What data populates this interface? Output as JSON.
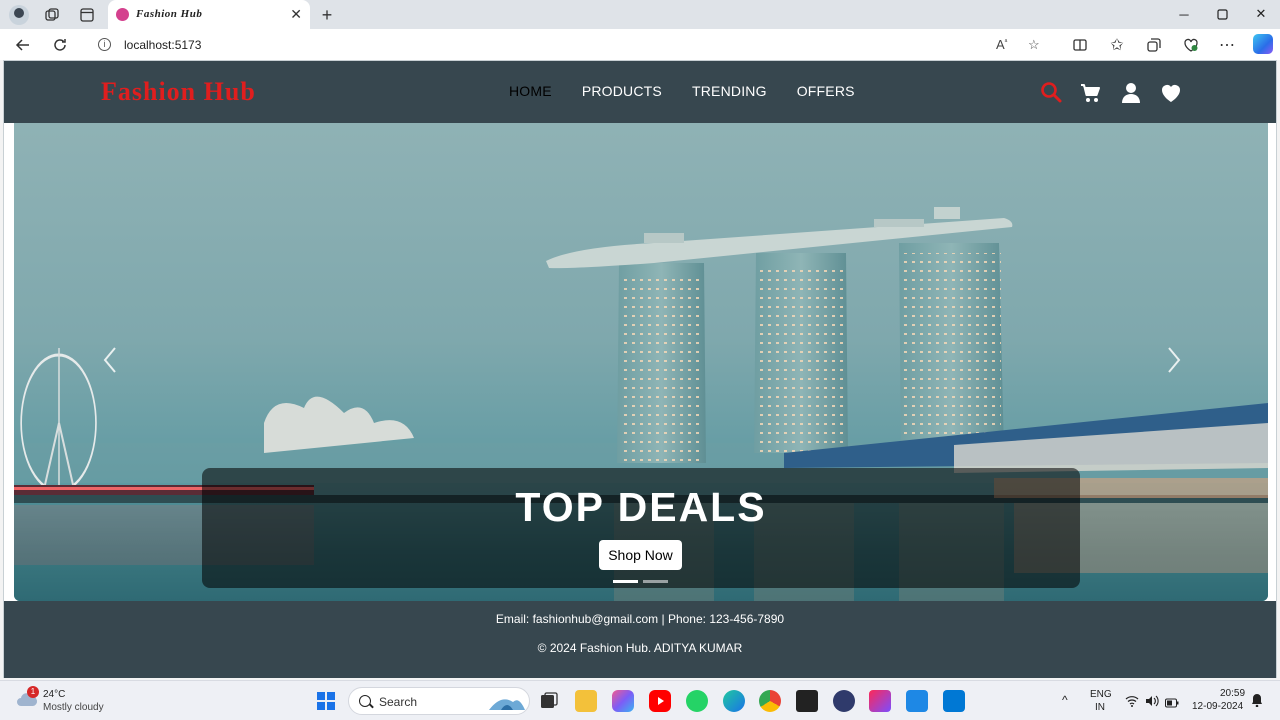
{
  "browser": {
    "tab_title": "Fashion Hub",
    "url": "localhost:5173"
  },
  "site": {
    "brand": "Fashion Hub",
    "menu": [
      "HOME",
      "PRODUCTS",
      "TRENDING",
      "OFFERS"
    ],
    "active_menu": "HOME",
    "icons": [
      "search-icon",
      "cart-icon",
      "user-icon",
      "heart-icon"
    ],
    "colors": {
      "navbar": "#37474f",
      "brand": "#e01e1e",
      "accent": "#e01e1e"
    }
  },
  "hero": {
    "caption_title": "TOP DEALS",
    "cta_label": "Shop Now",
    "slides_total": 2,
    "active_slide": 1
  },
  "footer": {
    "contact": "Email: fashionhub@gmail.com | Phone: 123-456-7890",
    "copyright": "© 2024 Fashion Hub. ADITYA KUMAR"
  },
  "taskbar": {
    "weather_temp": "24°C",
    "weather_desc": "Mostly cloudy",
    "notification_count": "1",
    "search_placeholder": "Search",
    "lang_top": "ENG",
    "lang_bottom": "IN",
    "time": "20:59",
    "date": "12-09-2024"
  }
}
